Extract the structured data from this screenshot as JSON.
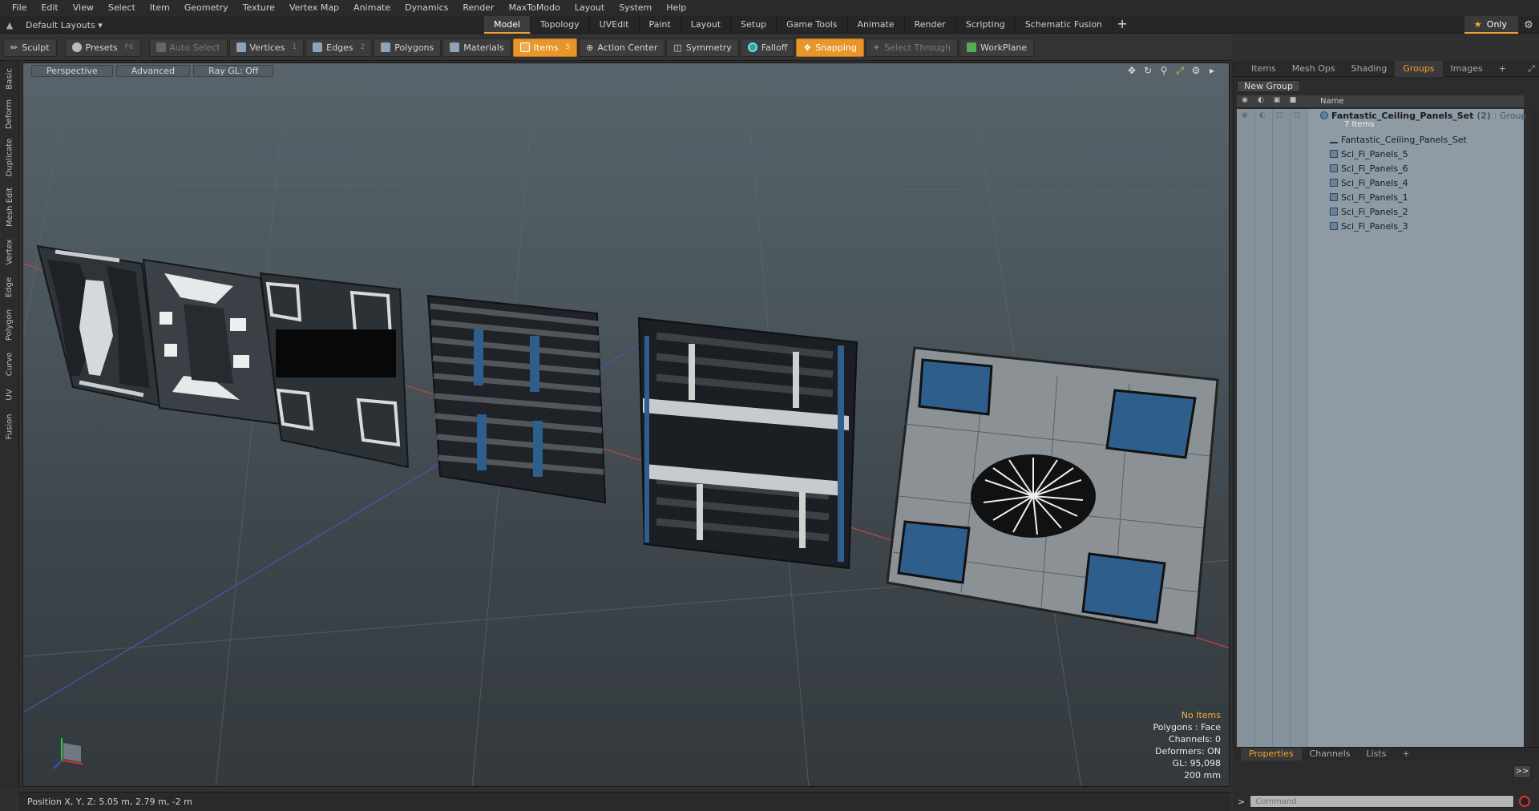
{
  "menu": [
    "File",
    "Edit",
    "View",
    "Select",
    "Item",
    "Geometry",
    "Texture",
    "Vertex Map",
    "Animate",
    "Dynamics",
    "Render",
    "MaxToModo",
    "Layout",
    "System",
    "Help"
  ],
  "layout": {
    "name": "Default Layouts ▾",
    "tabs": [
      "Model",
      "Topology",
      "UVEdit",
      "Paint",
      "Layout",
      "Setup",
      "Game Tools",
      "Animate",
      "Render",
      "Scripting",
      "Schematic Fusion"
    ],
    "active_tab": "Model",
    "only_label": "Only"
  },
  "toolbar": {
    "sculpt": "Sculpt",
    "presets": "Presets",
    "presets_key": "F6",
    "auto_select": "Auto Select",
    "vertices": "Vertices",
    "vertices_key": "1",
    "edges": "Edges",
    "edges_key": "2",
    "polygons": "Polygons",
    "materials": "Materials",
    "items": "Items",
    "items_key": "5",
    "action_center": "Action Center",
    "symmetry": "Symmetry",
    "falloff": "Falloff",
    "snapping": "Snapping",
    "select_through": "Select Through",
    "workplane": "WorkPlane"
  },
  "left_tabs": [
    "Basic",
    "Deform",
    "Duplicate",
    "Mesh Edit",
    "Vertex",
    "Edge",
    "Polygon",
    "Curve",
    "UV",
    "Fusion"
  ],
  "viewport": {
    "view": "Perspective",
    "shading": "Advanced",
    "raygl": "Ray GL: Off",
    "info": {
      "items": "No Items",
      "polygons": "Polygons : Face",
      "channels": "Channels: 0",
      "deformers": "Deformers: ON",
      "gl": "GL: 95,098",
      "grid": "200 mm"
    }
  },
  "status": "Position X, Y, Z:   5.05 m, 2.79 m, -2 m",
  "right_panel": {
    "tabs": [
      "Items",
      "Mesh Ops",
      "Shading",
      "Groups",
      "Images"
    ],
    "active_tab": "Groups",
    "new_group": "New Group",
    "name_col": "Name",
    "group": {
      "name": "Fantastic_Ceiling_Panels_Set",
      "count": "(2)",
      "type": ": Group",
      "sub": "7 Items"
    },
    "items": [
      "Fantastic_Ceiling_Panels_Set",
      "Sci_Fi_Panels_5",
      "Sci_Fi_Panels_6",
      "Sci_Fi_Panels_4",
      "Sci_Fi_Panels_1",
      "Sci_Fi_Panels_2",
      "Sci_Fi_Panels_3"
    ]
  },
  "bottom_panel": {
    "tabs": [
      "Properties",
      "Channels",
      "Lists"
    ],
    "active_tab": "Properties",
    "command_placeholder": "Command"
  },
  "colors": {
    "accent": "#f0a030",
    "viewport_bg": "#4b555c",
    "panel_blue": "#2e5e8c"
  }
}
